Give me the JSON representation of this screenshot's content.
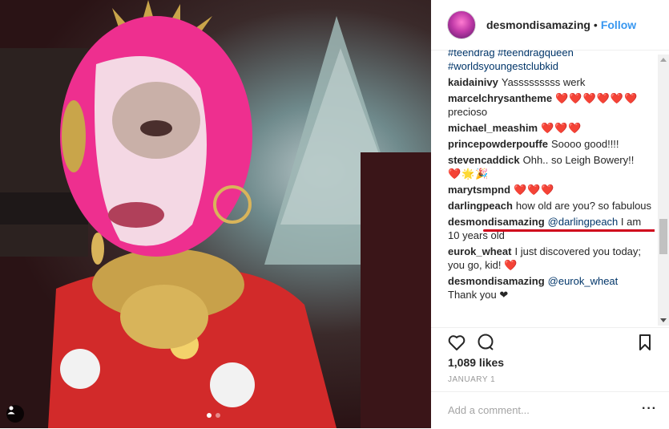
{
  "post": {
    "username": "desmondisamazing",
    "separator": "•",
    "follow_label": "Follow",
    "likes": "1,089 likes",
    "date": "JANUARY 1",
    "add_comment_placeholder": "Add a comment...",
    "more_label": "···",
    "carousel": {
      "count": 2,
      "active_index": 0
    }
  },
  "comments": [
    {
      "hashtags": "#teendrag #teendragqueen #worldsyoungestclubkid"
    },
    {
      "user": "kaidainivy",
      "text": "Yasssssssss werk"
    },
    {
      "user": "marcelchrysantheme",
      "text": "precioso",
      "hearts": "❤️❤️❤️❤️❤️❤️"
    },
    {
      "user": "michael_meashim",
      "text": "",
      "hearts": "❤️❤️❤️"
    },
    {
      "user": "princepowderpouffe",
      "text": "Soooo good!!!!"
    },
    {
      "user": "stevencaddick",
      "text": "Ohh.. so Leigh Bowery!!",
      "hearts": "❤️🌟🎉"
    },
    {
      "user": "marytsmpnd",
      "text": "",
      "hearts": "❤️❤️❤️"
    },
    {
      "user": "darlingpeach",
      "text": "how old are you? so fabulous"
    },
    {
      "user": "desmondisamazing",
      "mention": "@darlingpeach",
      "text": "I am 10 years old"
    },
    {
      "user": "eurok_wheat",
      "text": "I just discovered you today; you go, kid!",
      "hearts": "❤️"
    },
    {
      "user": "desmondisamazing",
      "mention": "@eurok_wheat",
      "text": "Thank you ❤"
    }
  ],
  "colors": {
    "link": "#3897f0",
    "heart": "#d61a2c",
    "underline": "#d0021b"
  }
}
